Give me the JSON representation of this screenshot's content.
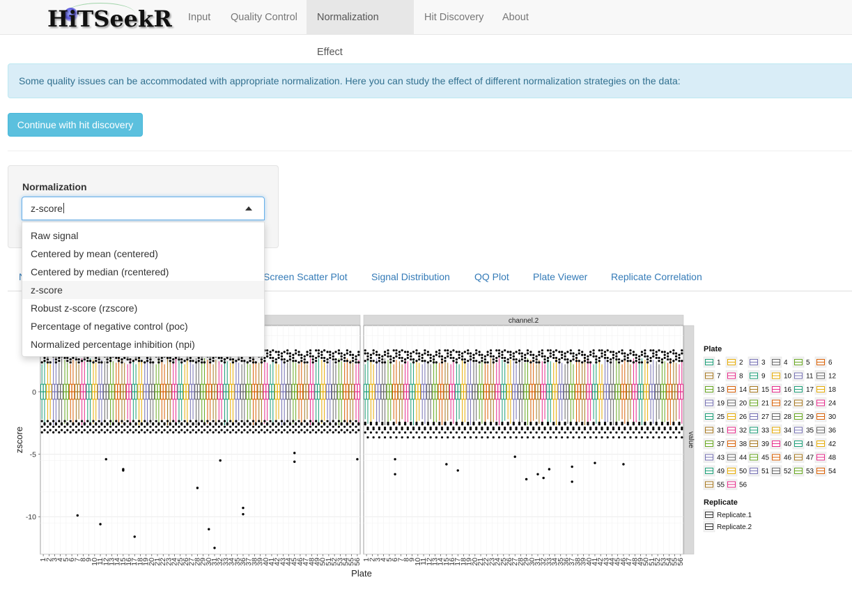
{
  "brand": {
    "name": "HiTSeekR"
  },
  "nav": {
    "items": [
      "Input",
      "Quality Control",
      "Normalization Effect",
      "Hit Discovery",
      "About"
    ],
    "active_index": 2
  },
  "alert": {
    "text": "Some quality issues can be accommodated with appropriate normalization. Here you can study the effect of different normalization strategies on the data:"
  },
  "continue_button": {
    "label": "Continue with hit discovery"
  },
  "normalization": {
    "label": "Normalization",
    "selected": "z-score",
    "options": [
      "Raw signal",
      "Centered by mean (centered)",
      "Centered by median (rcentered)",
      "z-score",
      "Robust z-score (rzscore)",
      "Percentage of negative control (poc)",
      "Normalized percentage inhibition (npi)"
    ]
  },
  "tabs": {
    "hidden_first": "N",
    "visible": [
      "Screen Scatter Plot",
      "Signal Distribution",
      "QQ Plot",
      "Plate Viewer",
      "Replicate Correlation"
    ]
  },
  "chart_data": {
    "type": "box",
    "facets": [
      "",
      "channel.2"
    ],
    "right_strip": "value",
    "xlabel": "Plate",
    "ylabel": "zscore",
    "yticks": [
      -10,
      -5,
      0
    ],
    "ylim": [
      -13,
      5.3
    ],
    "categories": [
      "1",
      "2",
      "3",
      "4",
      "5",
      "6",
      "7",
      "8",
      "9",
      "10",
      "11",
      "12",
      "13",
      "14",
      "15",
      "16",
      "17",
      "18",
      "19",
      "20",
      "21",
      "22",
      "23",
      "24",
      "25",
      "26",
      "27",
      "28",
      "29",
      "30",
      "31",
      "32",
      "33",
      "34",
      "35",
      "36",
      "37",
      "38",
      "39",
      "40",
      "41",
      "42",
      "43",
      "44",
      "45",
      "46",
      "47",
      "48",
      "49",
      "50",
      "51",
      "52",
      "53",
      "54",
      "55",
      "56"
    ],
    "replicates": [
      "Replicate.1",
      "Replicate.2"
    ],
    "box_stats_approx": {
      "median": 0,
      "q1": -0.6,
      "q3": 0.6,
      "whisker_low": -2.2,
      "whisker_high": 2.2
    },
    "outliers_panel1": [
      {
        "plate": 7,
        "y": -9.9
      },
      {
        "plate": 11,
        "y": -10.6
      },
      {
        "plate": 12,
        "y": -5.4
      },
      {
        "plate": 15,
        "y": -6.2
      },
      {
        "plate": 15,
        "y": -6.3
      },
      {
        "plate": 17,
        "y": -11.6
      },
      {
        "plate": 28,
        "y": -7.7
      },
      {
        "plate": 30,
        "y": -11.0
      },
      {
        "plate": 31,
        "y": -12.5
      },
      {
        "plate": 32,
        "y": -5.5
      },
      {
        "plate": 36,
        "y": -9.3
      },
      {
        "plate": 36,
        "y": -9.8
      },
      {
        "plate": 45,
        "y": -5.6
      },
      {
        "plate": 45,
        "y": -4.9
      },
      {
        "plate": 56,
        "y": -5.4
      }
    ],
    "outliers_panel2": [
      {
        "plate": 6,
        "y": -5.4
      },
      {
        "plate": 6,
        "y": -6.6
      },
      {
        "plate": 15,
        "y": -5.8
      },
      {
        "plate": 17,
        "y": -6.3
      },
      {
        "plate": 27,
        "y": -5.2
      },
      {
        "plate": 29,
        "y": -7.0
      },
      {
        "plate": 31,
        "y": -6.6
      },
      {
        "plate": 32,
        "y": -6.9
      },
      {
        "plate": 33,
        "y": -6.2
      },
      {
        "plate": 37,
        "y": -7.2
      },
      {
        "plate": 37,
        "y": -6.0
      },
      {
        "plate": 41,
        "y": -5.7
      },
      {
        "plate": 46,
        "y": -5.8
      }
    ],
    "legend": {
      "plate_title": "Plate",
      "replicate_title": "Replicate",
      "position": "right"
    },
    "palette": [
      "#1b9e77",
      "#e6ab02",
      "#7570b3",
      "#666666",
      "#66a61e",
      "#d95f02",
      "#a6761d",
      "#e7298a"
    ]
  },
  "colors": {
    "info_bg": "#d9edf7",
    "info_text": "#31708f",
    "button_bg": "#5bc0de",
    "link": "#337ab7"
  }
}
